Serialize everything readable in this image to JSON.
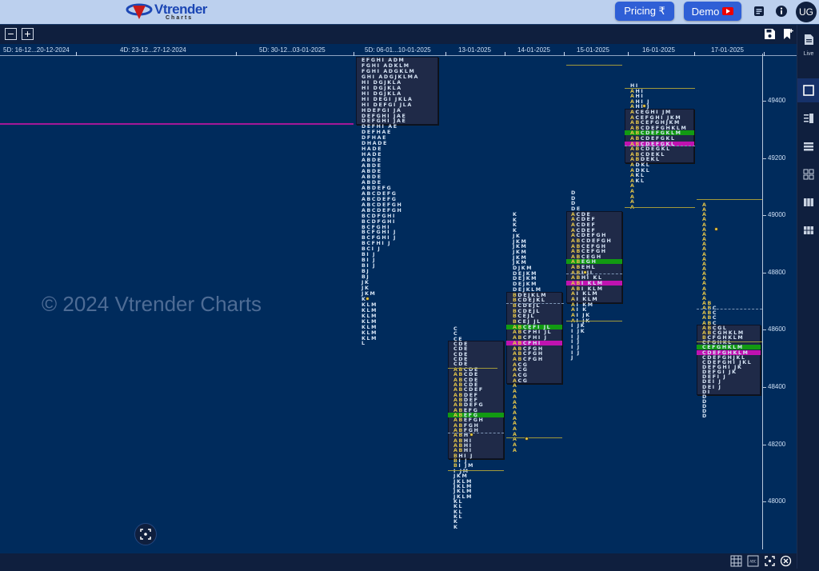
{
  "header": {
    "logo_text": "Vtrender",
    "logo_sub": "Charts",
    "pricing_label": "Pricing ₹",
    "demo_label": "Demo",
    "avatar_initials": "UG",
    "icons": [
      "notes-icon",
      "info-icon"
    ]
  },
  "toolbar": {
    "zoom_out": "−",
    "zoom_in": "+",
    "icons": [
      "save-icon",
      "bookmark-add-icon"
    ]
  },
  "sidebar": {
    "live_label": "Live",
    "items": [
      "single-view-icon",
      "split-view-icon",
      "rows-view-icon",
      "grid-view-icon",
      "columns-view-icon",
      "grid6-view-icon"
    ]
  },
  "chart": {
    "watermark": "© 2024 Vtrender Charts",
    "date_headers": [
      {
        "label": "5D: 16-12...20-12-2024"
      },
      {
        "label": "4D: 23-12...27-12-2024"
      },
      {
        "label": "5D: 30-12...03-01-2025"
      },
      {
        "label": "5D: 06-01...10-01-2025"
      },
      {
        "label": "13-01-2025"
      },
      {
        "label": "14-01-2025"
      },
      {
        "label": "15-01-2025"
      },
      {
        "label": "16-01-2025"
      },
      {
        "label": "17-01-2025"
      }
    ],
    "y_axis": {
      "labels": [
        "49400",
        "49200",
        "49000",
        "48800",
        "48600",
        "48400",
        "48200",
        "48000"
      ]
    },
    "colors": {
      "poc": "#129a12",
      "vwap": "#c012b0",
      "ib": "#e0c24a",
      "background": "#002b5c"
    },
    "profiles": [
      {
        "name": "06-01...10-01-2025",
        "rows": [
          "EFGHI ADM",
          "FGHI ADKLM",
          "FGHI ADGKLM",
          "GHI ADGJKLMA",
          "HI DGJKLA",
          "HI DGJKLA",
          "HI DGJKLA",
          "HI DEGI JKLA",
          "HI DEFGI JLA",
          "HDEFGI JA",
          "DEFGHI JAE",
          "DEFGHI JAE",
          "DEFHI AE",
          "DEFHAE",
          "DFHAE",
          "DHADE",
          "HADE",
          "HADE",
          "ABDE",
          "ABDE",
          "ABDE",
          "ABDE",
          "ABDE",
          "ABDEFG",
          "ABCDEFG",
          "ABCDEFG",
          "ABCDEFGH",
          "ABCDEFGH",
          "BCDFGHI",
          "BCDFGHI",
          "BCFGHI",
          "BCFGHI J",
          "BCFGHI J",
          "BCFHI J",
          "BCI J",
          "BI J",
          "BI J",
          "BI J",
          "BJ",
          "BJ",
          "JK",
          "JK",
          "JKM",
          "K",
          "KLM",
          "KLM",
          "KLM",
          "KLM",
          "KLM",
          "KLM",
          "KLM",
          "L"
        ]
      },
      {
        "name": "13-01-2025",
        "rows": [
          "C",
          "C",
          "CE",
          "CDE",
          "CDE",
          "CDE",
          "CDE",
          "CDE",
          "ABCDE",
          "ABCDE",
          "ABCDE",
          "ABCDE",
          "ABCDEF",
          "ABDEF",
          "ABDEF",
          "ABDEFG",
          "ABEFG",
          "ABEFG",
          "ABEFGH",
          "ABFGH",
          "ABFGH",
          "ABH",
          "ABHI",
          "ABHI",
          "ABHI",
          "BHI J",
          "BI J",
          "BI JM",
          "I JM",
          "JKM",
          "JKLM",
          "JKLM",
          "JKLM",
          "JKLM",
          "KL",
          "KL",
          "KL",
          "KL",
          "K",
          "K"
        ]
      },
      {
        "name": "14-01-2025",
        "rows": [
          "K",
          "K",
          "K",
          "K",
          "JK",
          "JKM",
          "JKM",
          "JKM",
          "JKM",
          "JKM",
          "DJKM",
          "DEJKM",
          "DEJKM",
          "DEJKM",
          "DEJKLM",
          "BDEJKLM",
          "BCDEJKL",
          "BCDEJL",
          "BCDEJL",
          "BCEJL",
          "BCEJ JL",
          "ABCEFI JL",
          "ABCFHI JL",
          "ABCFHI J",
          "ABCFHI",
          "ABCFGH",
          "ABCFGH",
          "ABCFGH",
          "ACG",
          "ACG",
          "ACG",
          "ACG",
          "A",
          "A",
          "A",
          "A",
          "A",
          "A",
          "A",
          "A",
          "A",
          "A",
          "A",
          "A",
          "A"
        ]
      },
      {
        "name": "15-01-2025",
        "rows": [
          "D",
          "D",
          "D",
          "DE",
          "ACDE",
          "ACDEF",
          "ACDEF",
          "ACDEF",
          "ACDEFGH",
          "ABCDEFGH",
          "ABCEFGH",
          "ABCEFGH",
          "ABCEGH",
          "ABEGH",
          "ABEHL",
          "ABHJL",
          "ABHI KL",
          "ABI KLM",
          "ABI KLM",
          "AI KLM",
          "AI KLM",
          "AI KM",
          "AI K",
          "AI JK",
          "AI JK",
          "I JK",
          "I JK",
          "I J",
          "I J",
          "I J",
          "I J",
          "J"
        ]
      },
      {
        "name": "16-01-2025",
        "rows": [
          "HI",
          "AHI",
          "AHI",
          "AHI J",
          "AHI J",
          "ACEGHI JM",
          "ACEFGHI JKM",
          "ABCEFGHJKM",
          "ABCDEFGHKLM",
          "ABCDEFGKLM",
          "ABCDEFGKL",
          "ABCDEFGKL",
          "ABCDEGKL",
          "ABCDEKL",
          "ABDEKL",
          "ADKL",
          "ADKL",
          "AKL",
          "AKL",
          "A",
          "A",
          "A",
          "A",
          "A"
        ]
      },
      {
        "name": "17-01-2025",
        "rows": [
          "A",
          "A",
          "A",
          "A",
          "A",
          "A",
          "A",
          "A",
          "A",
          "A",
          "A",
          "A",
          "A",
          "A",
          "A",
          "A",
          "A",
          "A",
          "A",
          "A",
          "AB",
          "ABC",
          "ABC",
          "ABC",
          "ABC",
          "ABCGL",
          "ABCGHKLM",
          "BCFGHKLM",
          "CFGHKL",
          "CEFGHKLM",
          "CDEFGHKLM",
          "CDEFGHJKL",
          "CDEFGHI JKL",
          "DEFGHI JK",
          "DEFGI JK",
          "DEFI J",
          "DEI J",
          "DEI J",
          "DI",
          "D",
          "D",
          "D",
          "D",
          "D"
        ]
      }
    ]
  }
}
